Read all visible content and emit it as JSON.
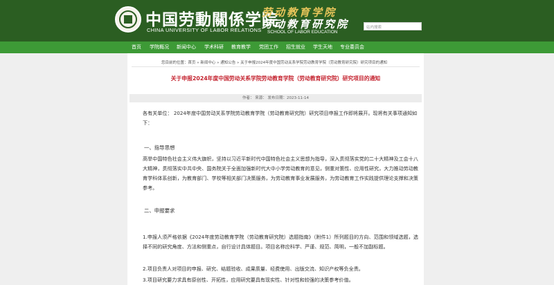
{
  "header": {
    "logo_cn": "中国劳動關係学院",
    "logo_en": "CHINA UNIVERSITY OF LABOR RELATIONS",
    "school_line1": "劳动教育学院",
    "school_line2": "劳动教育研究院",
    "school_en": "SCHOOL OF LABOR EDUCATION",
    "search_placeholder": "站内搜索"
  },
  "nav": {
    "items": [
      "首页",
      "学院概况",
      "新闻中心",
      "学术科研",
      "教育教学",
      "党团工作",
      "招生就业",
      "学生天地",
      "专业委员会"
    ]
  },
  "breadcrumb": "您目前的位置：首页 » 新闻中心 » 通知公告 » 关于申报2024年度中国劳动关系学院劳动教育学院（劳动教育研究院）研究项目的通知",
  "article": {
    "title": "关于申报2024年度中国劳动关系学院劳动教育学院（劳动教育研究院）研究项目的通知",
    "meta": "作者：     来源：     发布日期：2023-11-14",
    "greeting": "各有关单位：        2024年度中国劳动关系学院劳动教育学院（劳动教育研究院）研究项目申报工作即将展开。现将有关事项通知如下：",
    "section1_heading": "一、指导思想",
    "section1_body": "高举中国特色社会主义伟大旗帜，坚持以习近平新时代中国特色社会主义思想为指导，深入贯彻落实党的二十大精神及工会十八大精神，贯彻落实中共中央、国务院关于全面加强新时代大中小学劳动教育的意见，侧重对策性、应用性研究，大力推动劳动教育学科体系创新，为教育部门、学校等相关部门决策服务，为劳动教育事业发展服务，为劳动教育工作实践提供理论支撑和决策参考。",
    "section2_heading": "二、申报要求",
    "req1": "1.申报人须严格依据《2024年度劳动教育学院（劳动教育研究院）选题指南》（附件1）所列题目的方向、范围和领域选题，选择不同的研究角度、方法和侧重点，自行设计具体题目。项目名称应科学、严谨、规范、简明，一般不加副标题。",
    "req2": "2.项目负责人对项目的申报、研究、结题验收、成果质量、经费使用、出版交流、知识产权等负全责。",
    "req3": "3.项目研究要力求具有原创性、开拓性，应用研究要具有现实性、针对性和较强的决策参考价值。"
  }
}
